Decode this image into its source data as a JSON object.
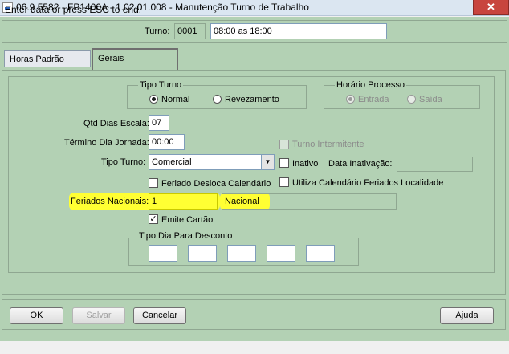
{
  "window": {
    "title": "06.9.5582 - FP1400A - 1.02.01.008 - Manutenção Turno de Trabalho",
    "close_glyph": "✕"
  },
  "header": {
    "turno_label": "Turno:",
    "turno_code": "0001",
    "turno_desc": "08:00 as 18:00"
  },
  "tabs": [
    {
      "label": "Horas Padrão",
      "active": false
    },
    {
      "label": "Gerais",
      "active": true
    }
  ],
  "tipo_turno_group": {
    "legend": "Tipo Turno",
    "options": [
      {
        "label": "Normal",
        "selected": true
      },
      {
        "label": "Revezamento",
        "selected": false
      }
    ]
  },
  "horario_processo_group": {
    "legend": "Horário Processo",
    "options": [
      {
        "label": "Entrada",
        "selected": true,
        "disabled": true
      },
      {
        "label": "Saída",
        "selected": false,
        "disabled": true
      }
    ]
  },
  "fields": {
    "qtd_dias_escala": {
      "label": "Qtd Dias Escala:",
      "value": "07"
    },
    "termino_dia_jornada": {
      "label": "Término Dia Jornada:",
      "value": "00:00"
    },
    "tipo_turno": {
      "label": "Tipo Turno:",
      "value": "Comercial"
    },
    "feriados_nacionais": {
      "label": "Feriados Nacionais:",
      "code": "1",
      "desc": "Nacional"
    },
    "data_inativacao": {
      "label": "Data Inativação:",
      "value": ""
    }
  },
  "checkboxes": {
    "turno_intermitente": {
      "label": "Turno Intermitente",
      "checked": false,
      "disabled": true
    },
    "inativo": {
      "label": "Inativo",
      "checked": false
    },
    "feriado_desloca": {
      "label": "Feriado Desloca Calendário",
      "checked": false
    },
    "utiliza_calendario": {
      "label": "Utiliza Calendário Feriados Localidade",
      "checked": false
    },
    "emite_cartao": {
      "label": "Emite Cartão",
      "checked": true
    }
  },
  "tipo_dia_desconto": {
    "legend": "Tipo Dia Para Desconto",
    "values": [
      "",
      "",
      "",
      "",
      ""
    ]
  },
  "buttons": {
    "ok": "OK",
    "salvar": "Salvar",
    "cancelar": "Cancelar",
    "ajuda": "Ajuda"
  },
  "status": {
    "text": "Enter data or press ESC to end."
  },
  "colors": {
    "form_bg": "#b3d1b4",
    "highlight": "#ffff33",
    "close_button": "#c8453e"
  },
  "glyphs": {
    "check": "✓",
    "dropdown": "▼"
  }
}
